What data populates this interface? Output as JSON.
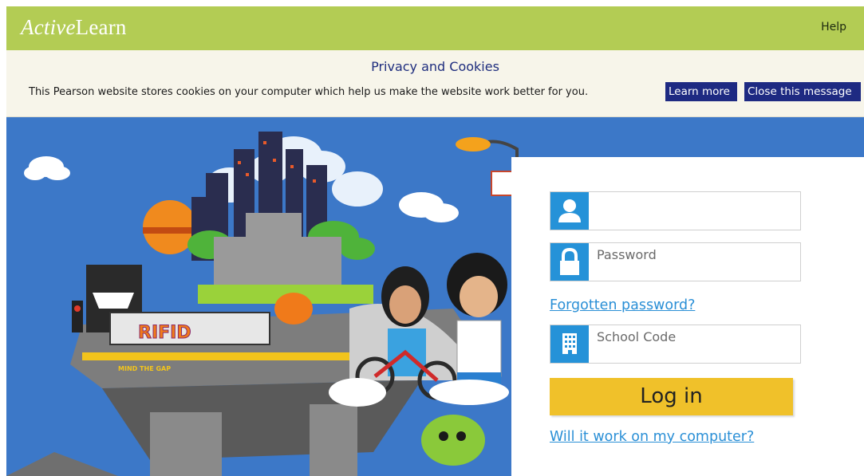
{
  "header": {
    "logo_part1": "Active",
    "logo_part2": "Learn",
    "help_label": "Help"
  },
  "cookie_banner": {
    "title": "Privacy and Cookies",
    "message": "This Pearson website stores cookies on your computer which help us make the website work better for you.",
    "learn_more_label": "Learn more",
    "close_label": "Close this message"
  },
  "login": {
    "username": {
      "value": "",
      "placeholder": "",
      "icon": "user-icon"
    },
    "password": {
      "value": "",
      "placeholder": "Password",
      "icon": "padlock-icon"
    },
    "forgotten_password_label": "Forgotten password?",
    "school_code": {
      "value": "",
      "placeholder": "School Code",
      "icon": "building-icon"
    },
    "login_label": "Log in",
    "compatibility_link_label": "Will it work on my computer?"
  },
  "hero": {
    "train_graffiti": "RIFID",
    "sign_text": "MIND THE GAP"
  },
  "colors": {
    "header_green": "#b3cc54",
    "banner_bg": "#f7f5ea",
    "banner_button": "#1e2a82",
    "sky_blue": "#3c78c8",
    "icon_blue": "#2592d8",
    "login_yellow": "#f0c12a",
    "link_blue": "#2a8fd6"
  }
}
